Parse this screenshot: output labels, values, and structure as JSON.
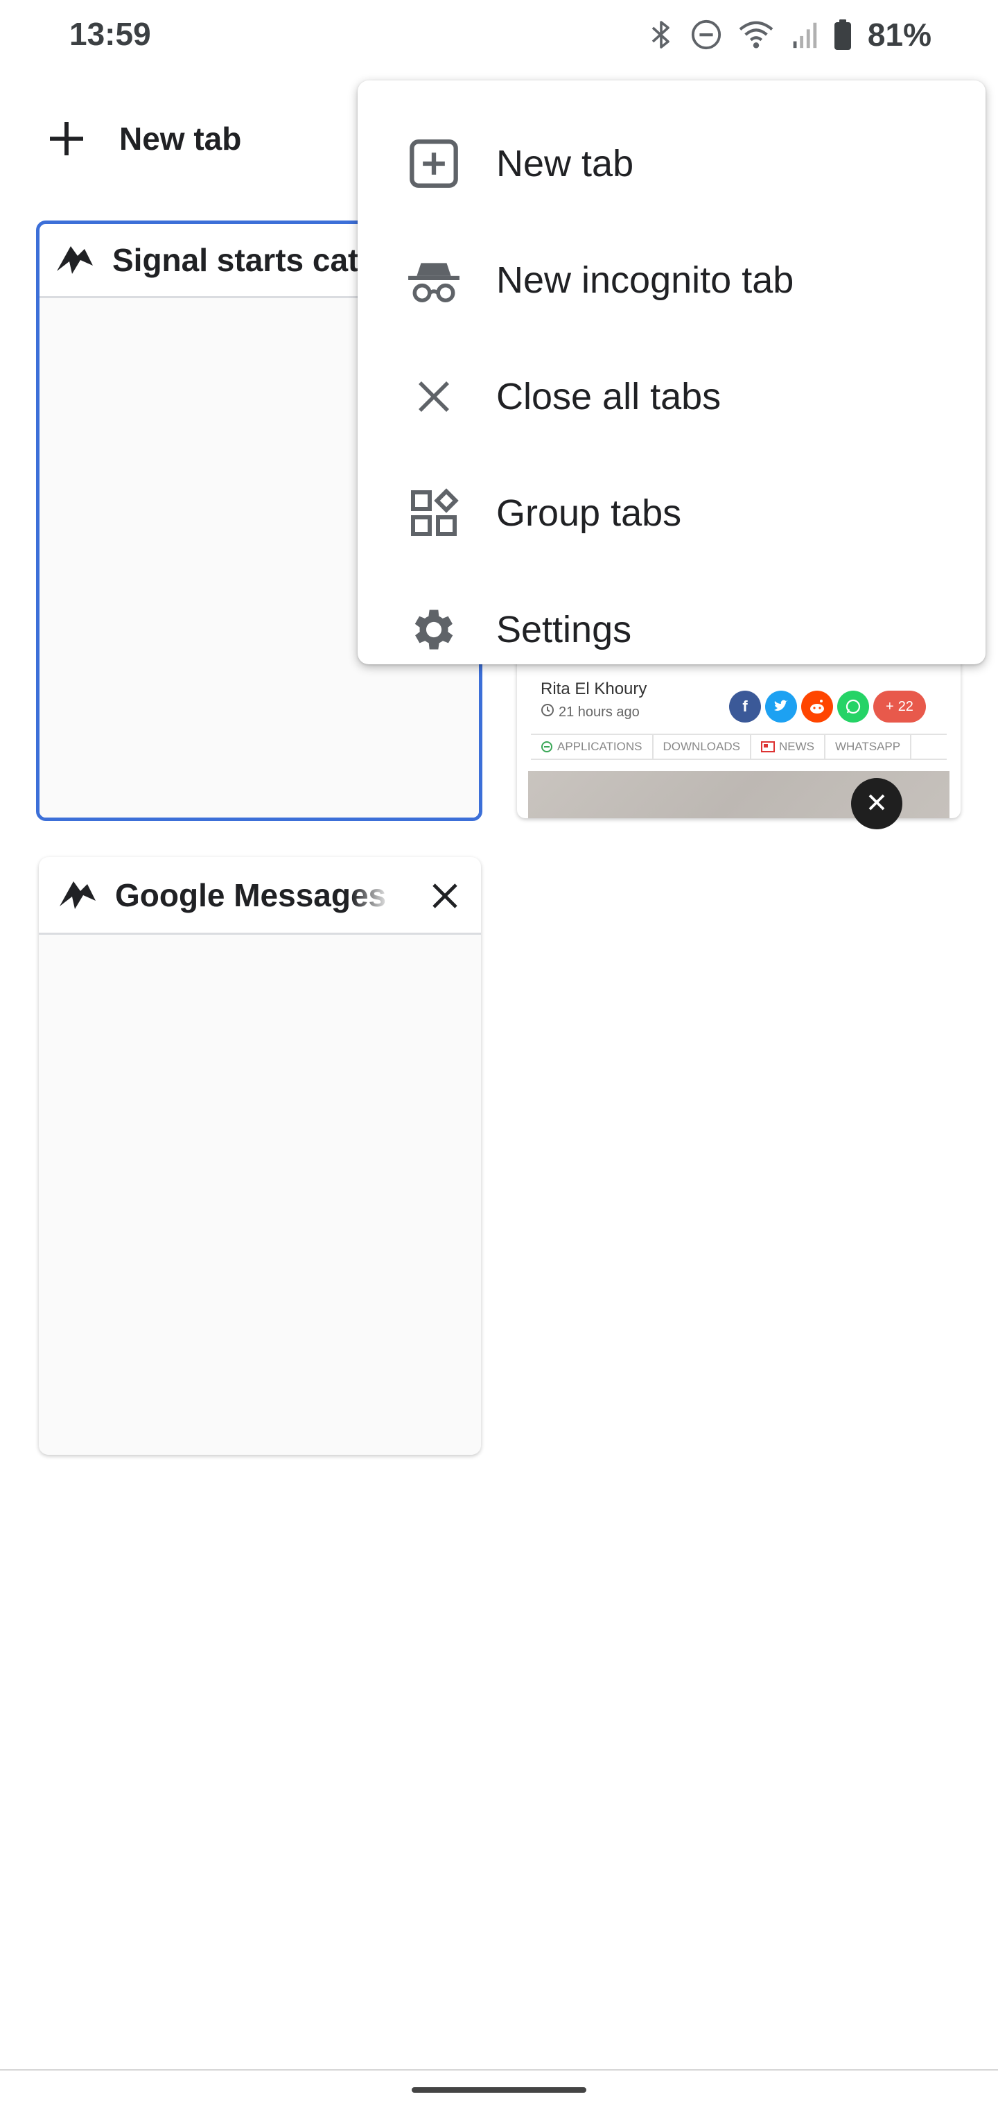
{
  "status_bar": {
    "time": "13:59",
    "battery": "81%",
    "icons": [
      "bluetooth-icon",
      "do-not-disturb-icon",
      "wifi-icon",
      "signal-icon",
      "battery-icon"
    ]
  },
  "toolbar": {
    "new_tab_label": "New tab"
  },
  "tabs": [
    {
      "title": "Signal starts catching up",
      "selected": true
    },
    {
      "title": "Google Messages on",
      "selected": false
    }
  ],
  "preview": {
    "author": "Rita El Khoury",
    "time": "21 hours ago",
    "share_count": "22",
    "categories": [
      "APPLICATIONS",
      "DOWNLOADS",
      "NEWS",
      "WHATSAPP"
    ]
  },
  "menu": {
    "items": [
      {
        "label": "New tab",
        "icon": "new-tab-icon"
      },
      {
        "label": "New incognito tab",
        "icon": "incognito-icon"
      },
      {
        "label": "Close all tabs",
        "icon": "close-icon"
      },
      {
        "label": "Group tabs",
        "icon": "group-tabs-icon"
      },
      {
        "label": "Settings",
        "icon": "gear-icon"
      }
    ]
  },
  "colors": {
    "selected_border": "#3c6fd8",
    "icon_gray": "#5f6368",
    "text": "#202124"
  }
}
